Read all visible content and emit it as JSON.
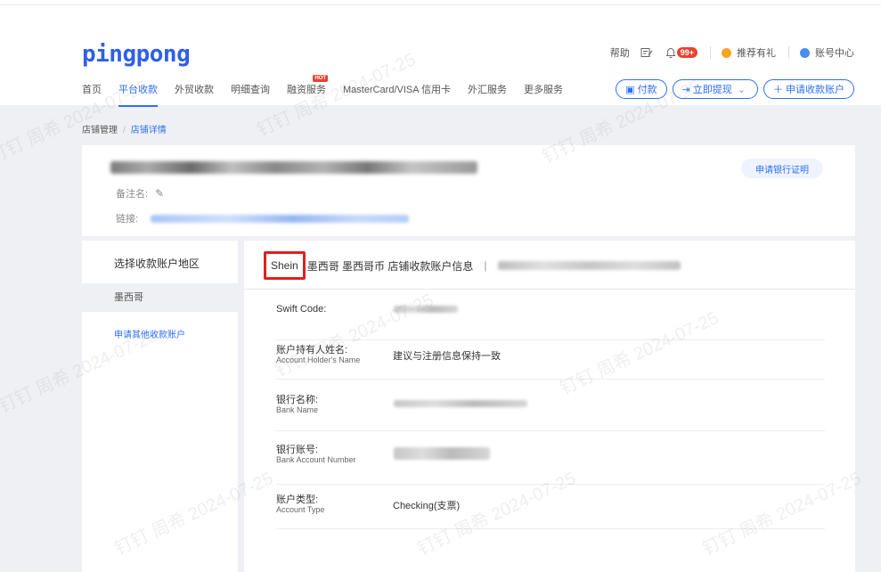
{
  "logo": "pingpong",
  "nav": {
    "items": [
      {
        "label": "首页",
        "active": false
      },
      {
        "label": "平台收款",
        "active": true
      },
      {
        "label": "外贸收款",
        "active": false
      },
      {
        "label": "明细查询",
        "active": false
      },
      {
        "label": "融资服务",
        "active": false,
        "badge": "HOT"
      },
      {
        "label": "MasterCard/VISA 信用卡",
        "active": false
      },
      {
        "label": "外汇服务",
        "active": false
      },
      {
        "label": "更多服务",
        "active": false
      }
    ]
  },
  "top_right": {
    "help": "帮助",
    "notification_count": "99+",
    "referral": "推荐有礼",
    "account": "账号中心"
  },
  "actions": {
    "pay": "付款",
    "withdraw": "立即提现",
    "apply_account": "申请收款账户"
  },
  "breadcrumb": {
    "parent": "店铺管理",
    "separator": "/",
    "current": "店铺详情"
  },
  "store": {
    "remark_label": "备注名:",
    "link_label": "链接:",
    "bank_cert_button": "申请银行证明"
  },
  "left_panel": {
    "title": "选择收款账户地区",
    "selected_region": "墨西哥",
    "apply_other": "申请其他收款账户"
  },
  "right_panel": {
    "header_highlight": "Shein",
    "header_text": "墨西哥 墨西哥币 店铺收款账户信息",
    "header_separator": "|",
    "fields": [
      {
        "label": "Swift Code:",
        "label_en": "",
        "value": ""
      },
      {
        "label": "账户持有人姓名:",
        "label_en": "Account Holder's Name",
        "value": "建议与注册信息保持一致"
      },
      {
        "label": "银行名称:",
        "label_en": "Bank Name",
        "value": ""
      },
      {
        "label": "银行账号:",
        "label_en": "Bank Account Number",
        "value": ""
      },
      {
        "label": "账户类型:",
        "label_en": "Account Type",
        "value": "Checking(支票)"
      }
    ]
  },
  "colors": {
    "primary": "#2f6ff0",
    "logo": "#2f5fe7",
    "highlight_border": "#e01f1f",
    "badge": "#e8432f",
    "background": "#eef0f4"
  }
}
